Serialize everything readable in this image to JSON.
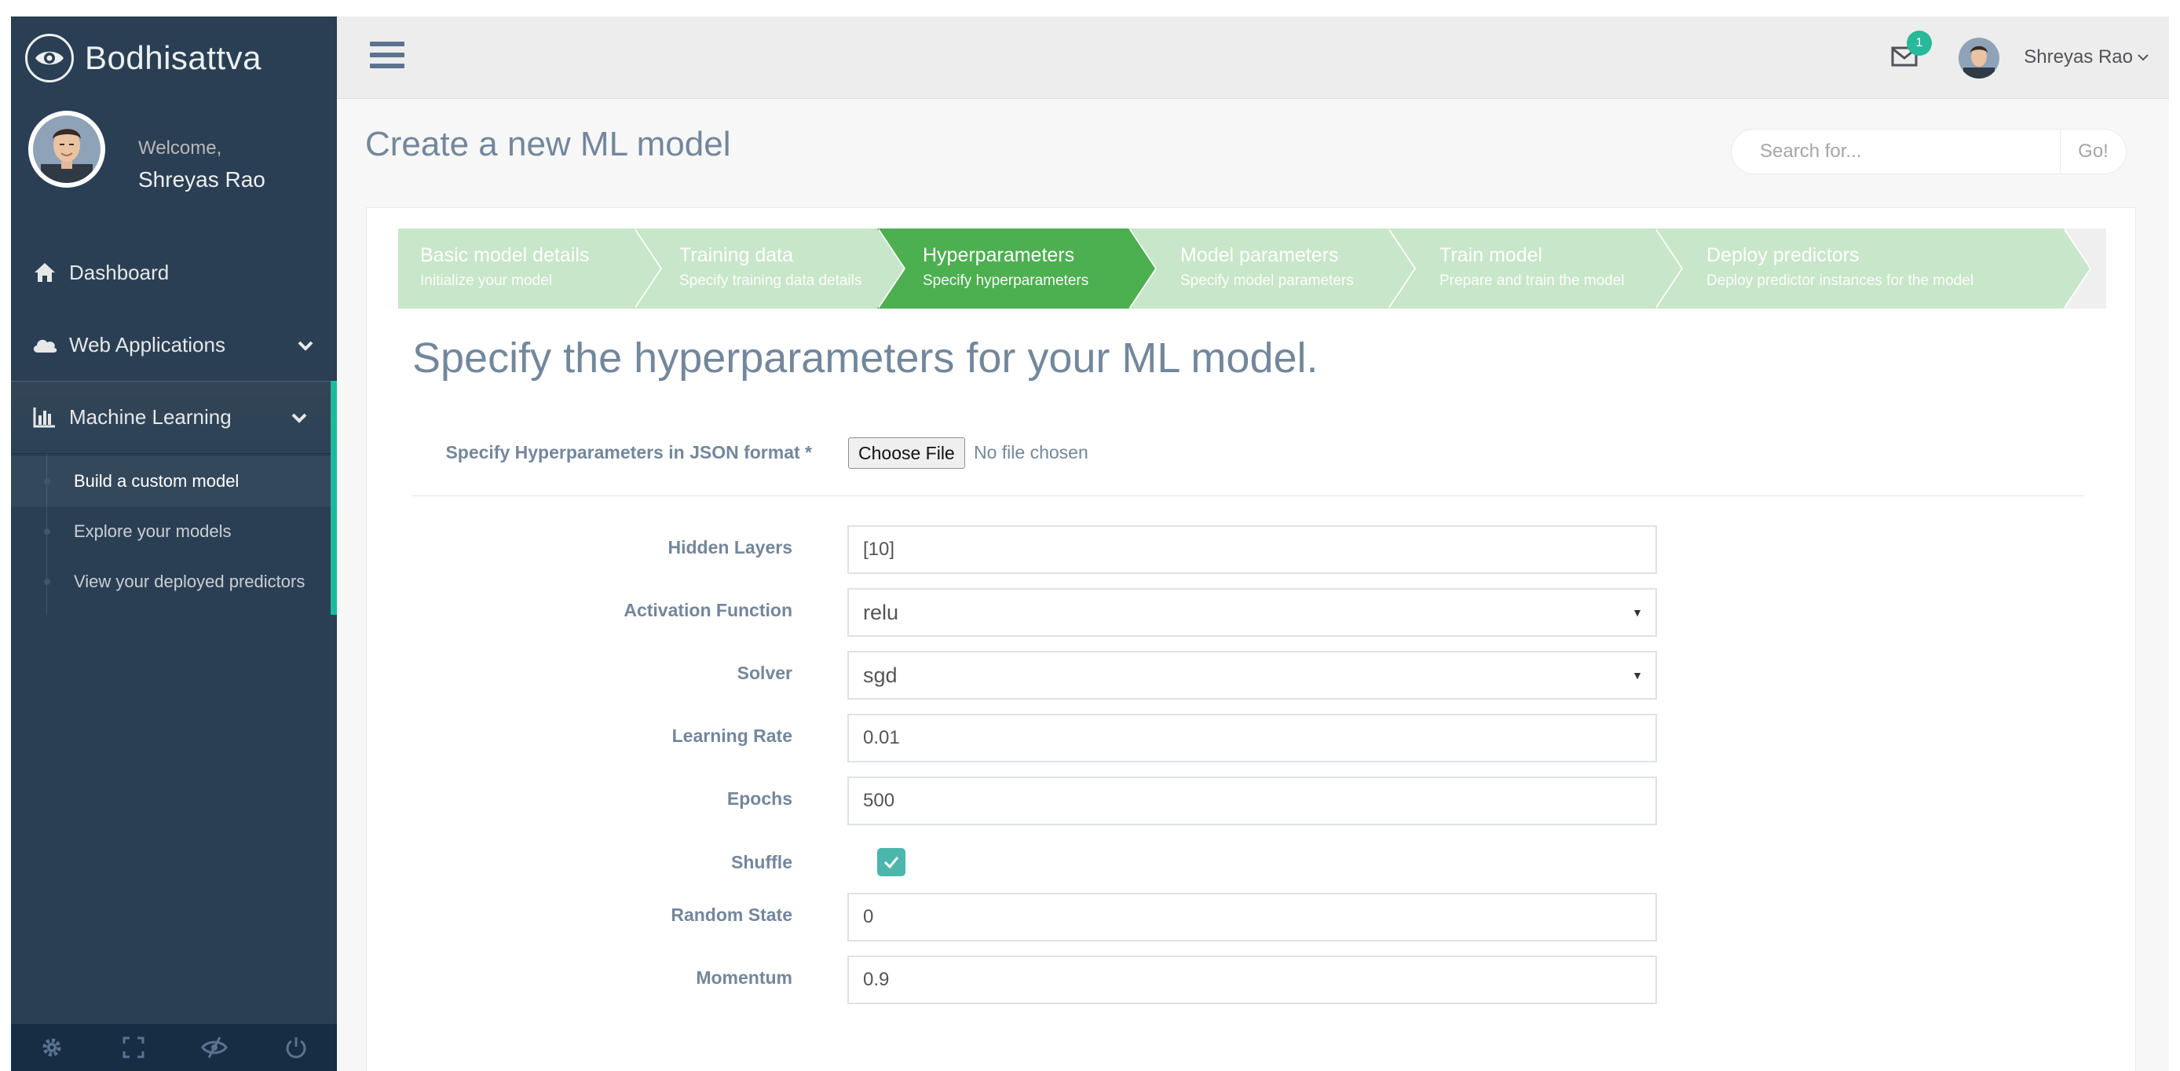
{
  "brand": {
    "name": "Bodhisattva"
  },
  "profile": {
    "welcome": "Welcome,",
    "name": "Shreyas Rao"
  },
  "sidebar": {
    "items": [
      {
        "label": "Dashboard",
        "icon": "home-icon"
      },
      {
        "label": "Web Applications",
        "icon": "cloud-icon"
      },
      {
        "label": "Machine Learning",
        "icon": "bar-chart-icon"
      }
    ],
    "submenu": [
      {
        "label": "Build a custom model"
      },
      {
        "label": "Explore your models"
      },
      {
        "label": "View your deployed predictors"
      }
    ],
    "footer_icons": [
      "settings-icon",
      "fullscreen-icon",
      "eye-slash-icon",
      "power-icon"
    ]
  },
  "topnav": {
    "mail_badge": "1",
    "user_name": "Shreyas Rao"
  },
  "page": {
    "title": "Create a new ML model",
    "search_placeholder": "Search for...",
    "search_button": "Go!"
  },
  "wizard": {
    "steps": [
      {
        "title": "Basic model details",
        "subtitle": "Initialize your model",
        "state": "done"
      },
      {
        "title": "Training data",
        "subtitle": "Specify training data details",
        "state": "done"
      },
      {
        "title": "Hyperparameters",
        "subtitle": "Specify hyperparameters",
        "state": "active"
      },
      {
        "title": "Model parameters",
        "subtitle": "Specify model parameters",
        "state": "todo"
      },
      {
        "title": "Train model",
        "subtitle": "Prepare and train the model",
        "state": "todo"
      },
      {
        "title": "Deploy predictors",
        "subtitle": "Deploy predictor instances for the model",
        "state": "todo"
      }
    ]
  },
  "form": {
    "heading": "Specify the hyperparameters for your ML model.",
    "json_label": "Specify Hyperparameters in JSON format *",
    "file_button": "Choose File",
    "file_status": "No file chosen",
    "fields": {
      "hidden_layers": {
        "label": "Hidden Layers",
        "value": "[10]"
      },
      "activation": {
        "label": "Activation Function",
        "value": "relu"
      },
      "solver": {
        "label": "Solver",
        "value": "sgd"
      },
      "learning_rate": {
        "label": "Learning Rate",
        "value": "0.01"
      },
      "epochs": {
        "label": "Epochs",
        "value": "500"
      },
      "shuffle": {
        "label": "Shuffle",
        "checked": true
      },
      "random_state": {
        "label": "Random State",
        "value": "0"
      },
      "momentum": {
        "label": "Momentum",
        "value": "0.9"
      }
    }
  },
  "colors": {
    "sidebar_bg": "#2A3F54",
    "accent": "#1ABB9C",
    "wizard_active": "#4CAF50",
    "wizard_inactive": "#C8E6C9",
    "checkbox": "#4DB6AC"
  }
}
